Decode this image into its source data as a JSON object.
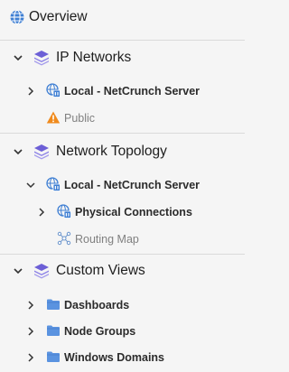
{
  "tree": {
    "overview": {
      "label": "Overview",
      "icon": "globe-icon"
    },
    "ip_networks": {
      "label": "IP Networks",
      "icon": "layers-icon",
      "children": [
        {
          "label": "Local - NetCrunch Server",
          "icon": "network-globe-icon"
        },
        {
          "label": "Public",
          "icon": "warning-icon"
        }
      ]
    },
    "network_topology": {
      "label": "Network Topology",
      "icon": "layers-icon",
      "children": [
        {
          "label": "Local - NetCrunch Server",
          "icon": "network-globe-icon"
        },
        {
          "label": "Physical Connections",
          "icon": "network-globe-icon"
        },
        {
          "label": "Routing Map",
          "icon": "routing-map-icon"
        }
      ]
    },
    "custom_views": {
      "label": "Custom Views",
      "icon": "layers-icon",
      "children": [
        {
          "label": "Dashboards",
          "icon": "folder-icon"
        },
        {
          "label": "Node Groups",
          "icon": "folder-icon"
        },
        {
          "label": "Windows Domains",
          "icon": "folder-icon"
        }
      ]
    }
  },
  "colors": {
    "background": "#f5f5f5",
    "accent_blue": "#3f7fd3",
    "layers_purple": "#6c5fd6",
    "warning_orange": "#f08a1c",
    "folder_blue": "#5a93e0"
  }
}
